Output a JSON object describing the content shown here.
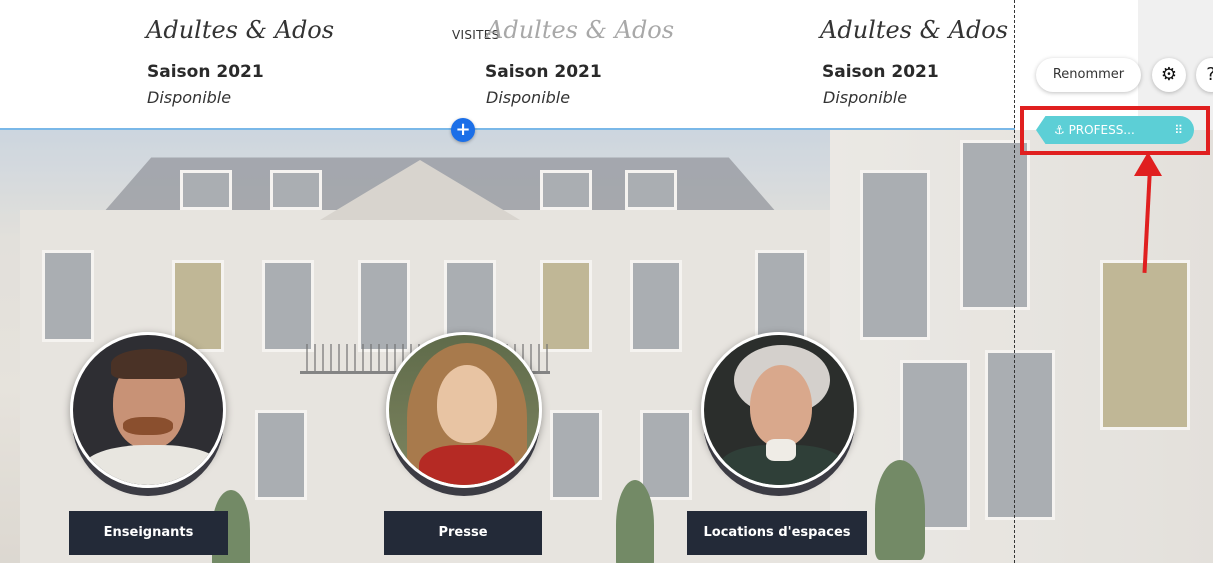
{
  "header": {
    "visites_label": "VISITES",
    "columns": [
      {
        "title": "Adultes & Ados",
        "season": "Saison 2021",
        "availability": "Disponible"
      },
      {
        "title": "Adultes & Ados",
        "season": "Saison 2021",
        "availability": "Disponible"
      },
      {
        "title": "Adultes & Ados",
        "season": "Saison 2021",
        "availability": "Disponible"
      }
    ]
  },
  "section": {
    "add_button_label": "+"
  },
  "editor": {
    "rename_label": "Renommer",
    "settings_icon": "gear-icon",
    "help_icon": "help-icon",
    "anchor_label": "⚓ PROFESS...",
    "drag_handle": "⠿"
  },
  "cards": [
    {
      "label": "Enseignants",
      "icon": "portrait-man-ruff"
    },
    {
      "label": "Presse",
      "icon": "portrait-madonna"
    },
    {
      "label": "Locations d'espaces",
      "icon": "portrait-man-wig"
    }
  ],
  "colors": {
    "accent_blue": "#1b6fe8",
    "anchor_teal": "#5ccfd6",
    "highlight_red": "#e01f1f",
    "label_dark": "#232a38"
  }
}
